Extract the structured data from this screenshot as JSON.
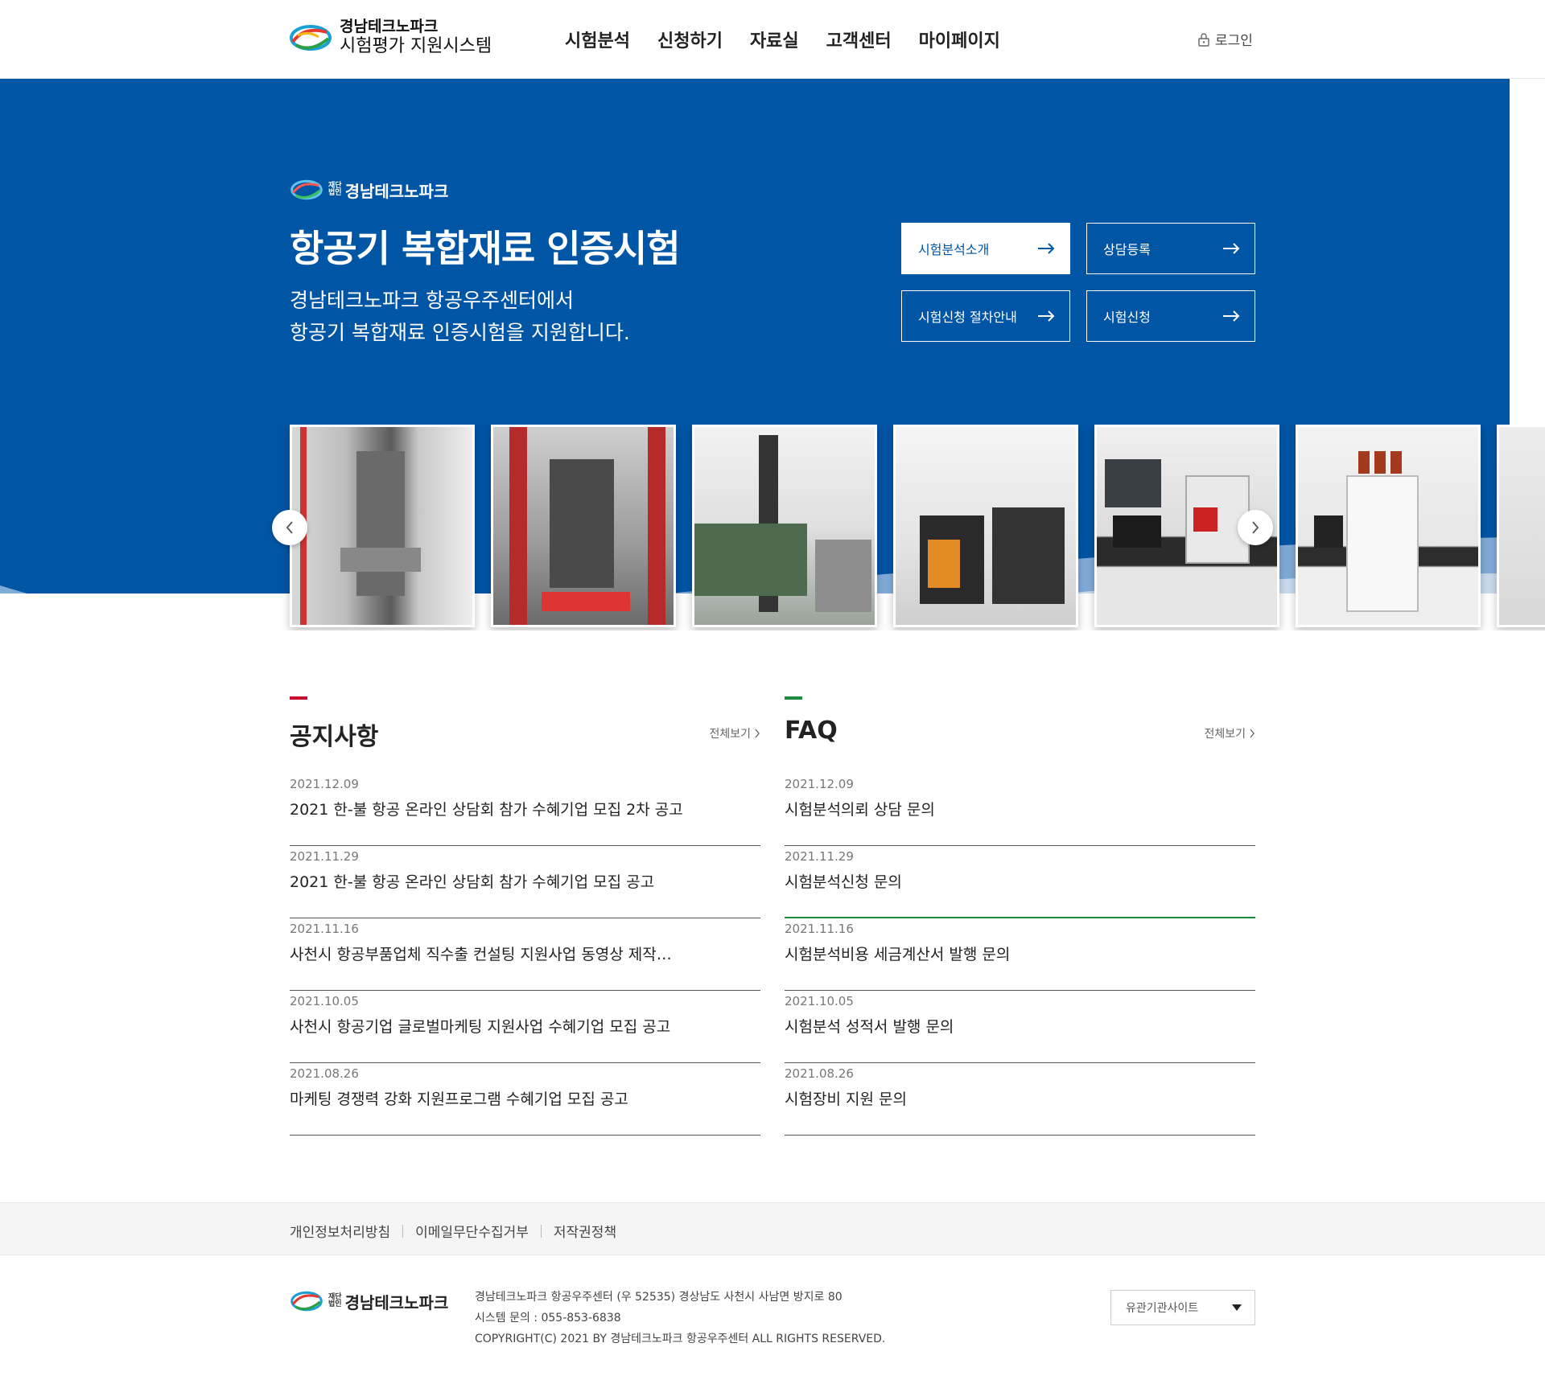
{
  "header": {
    "logo_line1": "경남테크노파크",
    "logo_line2": "시험평가 지원시스템",
    "nav": [
      "시험분석",
      "신청하기",
      "자료실",
      "고객센터",
      "마이페이지"
    ],
    "login_label": "로그인"
  },
  "hero": {
    "brand_small_1": "재단",
    "brand_small_2": "법인",
    "brand_name": "경남테크노파크",
    "title": "항공기 복합재료 인증시험",
    "desc_line1": "경남테크노파크 항공우주센터에서",
    "desc_line2": "항공기 복합재료 인증시험을 지원합니다.",
    "buttons": [
      {
        "label": "시험분석소개",
        "active": true
      },
      {
        "label": "상담등록",
        "active": false
      },
      {
        "label": "시험신청 절차안내",
        "active": false
      },
      {
        "label": "시험신청",
        "active": false
      }
    ]
  },
  "notice": {
    "title": "공지사항",
    "more": "전체보기",
    "items": [
      {
        "date": "2021.12.09",
        "subject": "2021 한-불 항공 온라인 상담회 참가 수혜기업 모집 2차 공고"
      },
      {
        "date": "2021.11.29",
        "subject": "2021 한-불 항공 온라인 상담회 참가 수혜기업 모집 공고"
      },
      {
        "date": "2021.11.16",
        "subject": "사천시 항공부품업체 직수출 컨설팅 지원사업 동영상 제작…"
      },
      {
        "date": "2021.10.05",
        "subject": "사천시 항공기업 글로벌마케팅 지원사업 수혜기업 모집 공고"
      },
      {
        "date": "2021.08.26",
        "subject": "마케팅 경쟁력 강화 지원프로그램 수혜기업 모집 공고"
      }
    ]
  },
  "faq": {
    "title": "FAQ",
    "more": "전체보기",
    "items": [
      {
        "date": "2021.12.09",
        "subject": "시험분석의뢰 상담 문의"
      },
      {
        "date": "2021.11.29",
        "subject": "시험분석신청 문의"
      },
      {
        "date": "2021.11.16",
        "subject": "시험분석비용 세금계산서 발행 문의"
      },
      {
        "date": "2021.10.05",
        "subject": "시험분석 성적서 발행 문의"
      },
      {
        "date": "2021.08.26",
        "subject": "시험장비 지원 문의"
      }
    ]
  },
  "footer": {
    "links": [
      "개인정보처리방침",
      "이메일무단수집거부",
      "저작권정책"
    ],
    "brand_small_1": "재단",
    "brand_small_2": "법인",
    "brand_name": "경남테크노파크",
    "address": "경남테크노파크 항공우주센터 (우 52535) 경상남도 사천시 사남면 방지로 80",
    "contact": "시스템 문의 : 055-853-6838",
    "copyright": "COPYRIGHT(C) 2021 BY 경남테크노파크 항공우주센터 ALL RIGHTS RESERVED.",
    "family_site": "유관기관사이트"
  },
  "colors": {
    "primary": "#0055a5",
    "notice_accent": "#c8102e",
    "faq_accent": "#1a8a3c"
  }
}
